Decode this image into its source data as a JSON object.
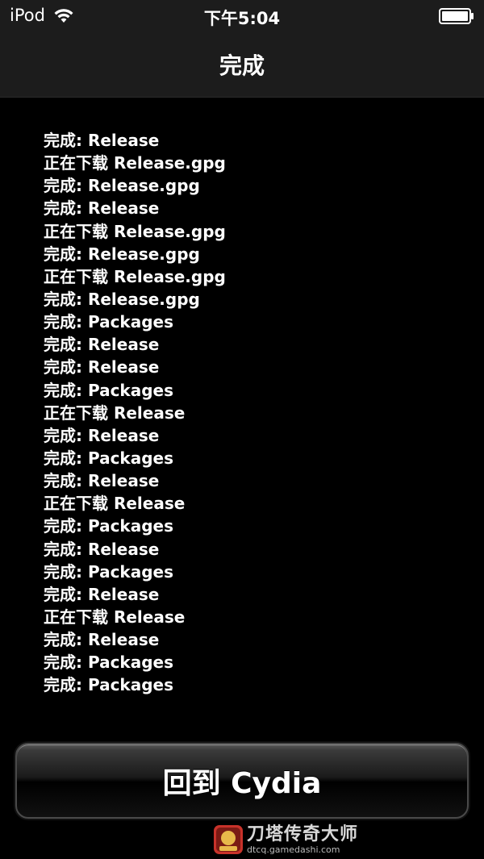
{
  "status_bar": {
    "carrier": "iPod",
    "time": "下午5:04"
  },
  "nav": {
    "title": "完成"
  },
  "log_lines": [
    "完成: Release",
    "正在下载 Release.gpg",
    "完成: Release.gpg",
    "完成: Release",
    "正在下载 Release.gpg",
    "完成: Release.gpg",
    "正在下载 Release.gpg",
    "完成: Release.gpg",
    "完成: Packages",
    "完成: Release",
    "完成: Release",
    "完成: Packages",
    "正在下载 Release",
    "完成: Release",
    "完成: Packages",
    "完成: Release",
    "正在下载 Release",
    "完成: Packages",
    "完成: Release",
    "完成: Packages",
    "完成: Release",
    "正在下载 Release",
    "完成: Release",
    "完成: Packages",
    "完成: Packages"
  ],
  "return_button": {
    "label": "回到 Cydia"
  },
  "watermark": {
    "title": "刀塔传奇大师",
    "url": "dtcq.gamedashi.com"
  },
  "colors": {
    "background": "#000000",
    "bar": "#1c1c1c",
    "text": "#ffffff",
    "logo_red": "#c8322a",
    "logo_gold": "#e8b84a"
  },
  "icons": {
    "wifi": "wifi-icon",
    "battery": "battery-icon",
    "logo": "gamedashi-logo-icon"
  }
}
